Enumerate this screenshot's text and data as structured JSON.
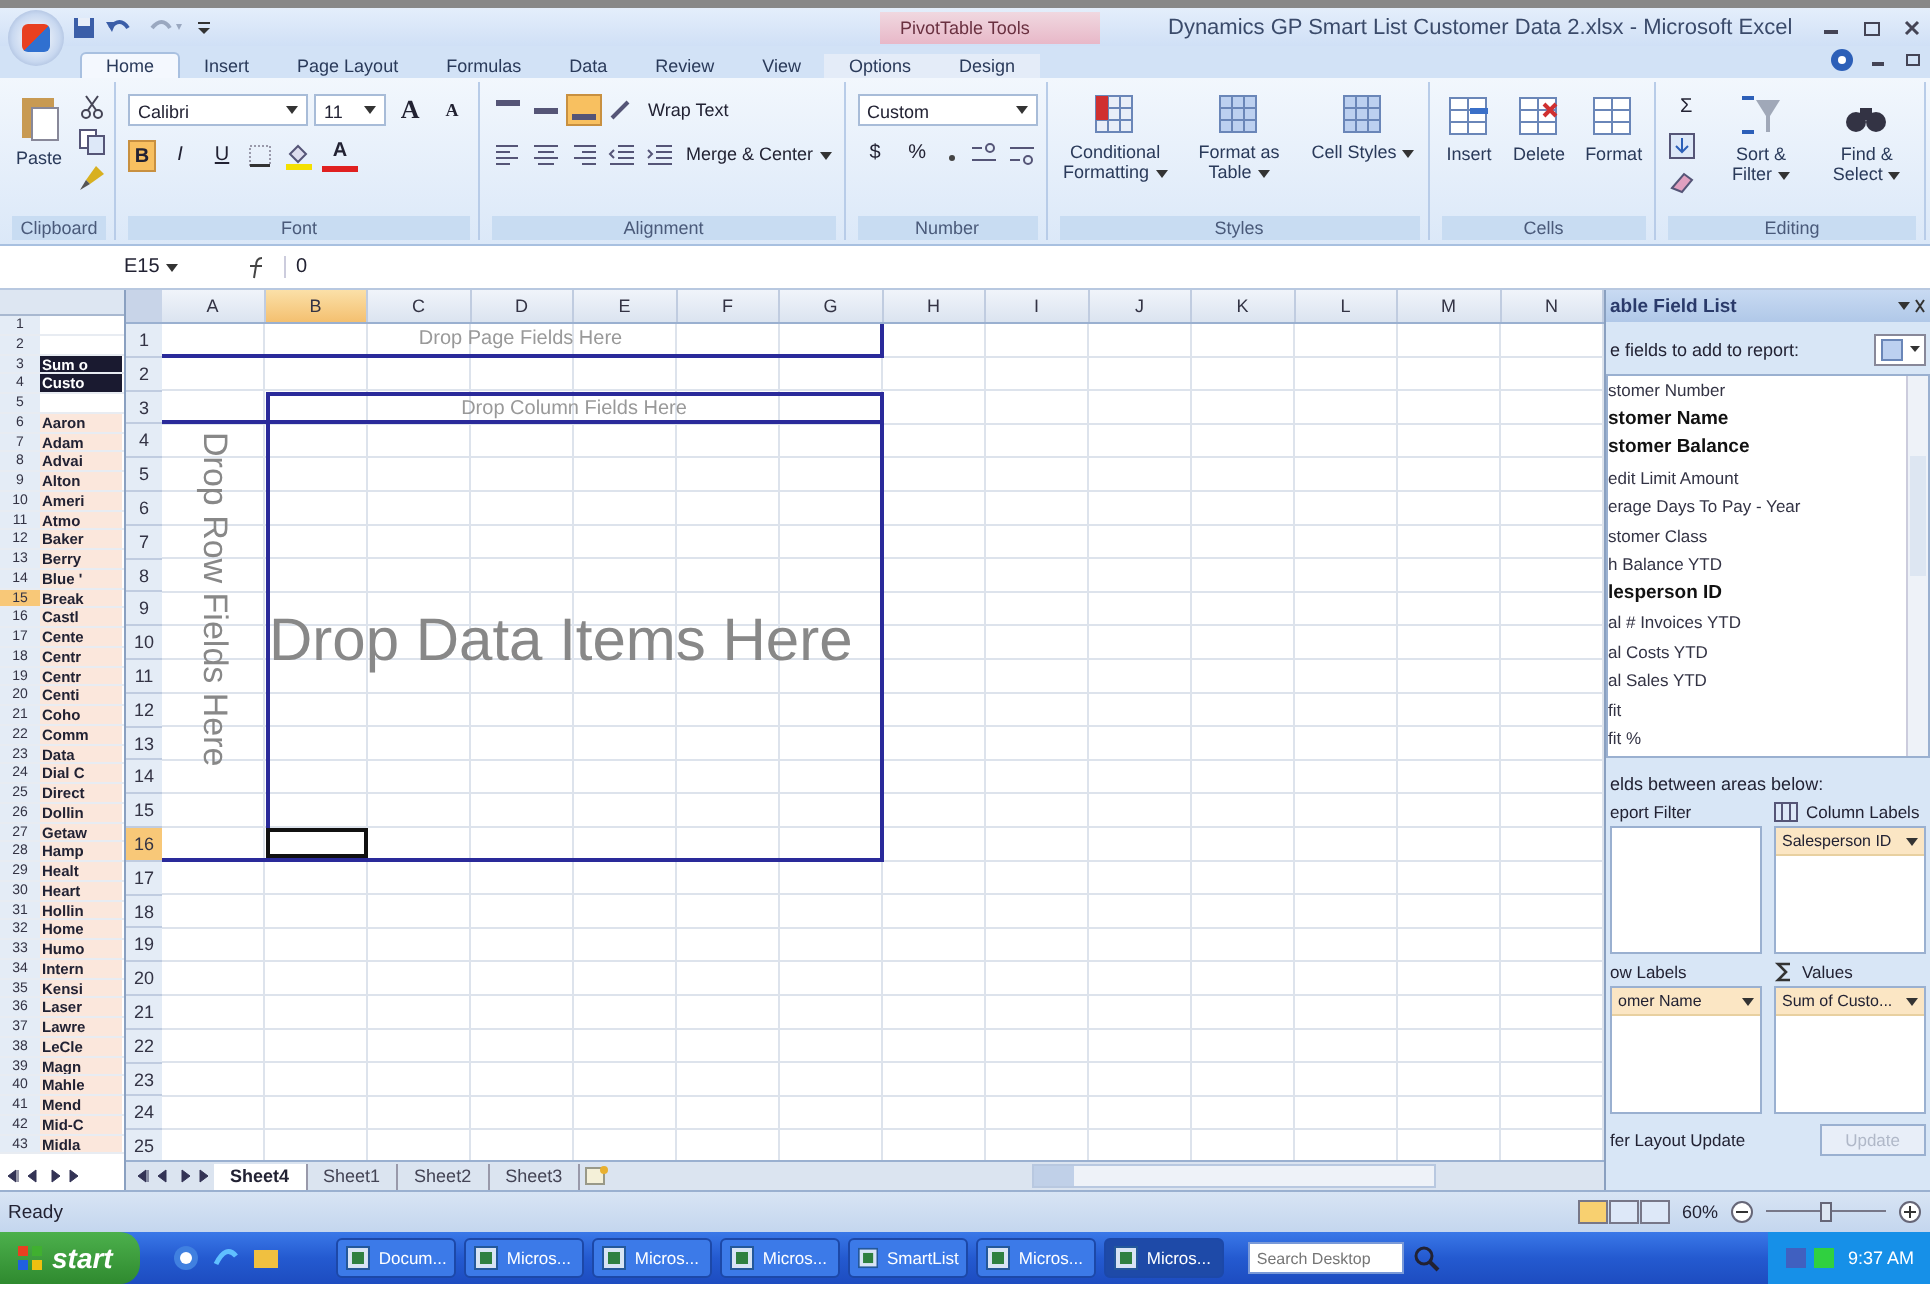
{
  "title_bar": {
    "context_label": "PivotTable Tools",
    "title": "Dynamics GP Smart List Customer Data 2.xlsx - Microsoft Excel"
  },
  "ribbon_tabs": [
    {
      "label": "Home",
      "selected": true
    },
    {
      "label": "Insert",
      "selected": false
    },
    {
      "label": "Page Layout",
      "selected": false
    },
    {
      "label": "Formulas",
      "selected": false
    },
    {
      "label": "Data",
      "selected": false
    },
    {
      "label": "Review",
      "selected": false
    },
    {
      "label": "View",
      "selected": false
    },
    {
      "label": "Options",
      "selected": false
    },
    {
      "label": "Design",
      "selected": false
    }
  ],
  "ribbon": {
    "clipboard": {
      "paste": "Paste",
      "label": "Clipboard"
    },
    "font": {
      "name": "Calibri",
      "size": "11",
      "grow": "A",
      "shrink": "A",
      "bold": {
        "label": "B",
        "on": true
      },
      "italic": "I",
      "underline": "U",
      "color_button": "A",
      "label": "Font"
    },
    "alignment": {
      "middle_on": true,
      "wrap": "Wrap Text",
      "merge": "Merge & Center",
      "label": "Alignment"
    },
    "number": {
      "format": "Custom",
      "currency": "$",
      "percent": "%",
      "label": "Number"
    },
    "styles": {
      "buttons": [
        "Conditional Formatting",
        "Format as Table",
        "Cell Styles"
      ],
      "label": "Styles"
    },
    "cells": {
      "buttons": [
        "Insert",
        "Delete",
        "Format"
      ],
      "label": "Cells"
    },
    "editing": {
      "buttons": [
        "Sort & Filter",
        "Find & Select"
      ],
      "sum": "Σ",
      "label": "Editing"
    }
  },
  "formula_bar": {
    "name_box": "E15",
    "value": "0"
  },
  "background_sheet": {
    "rows": [
      {
        "number": "1",
        "selected": false
      },
      {
        "number": "2",
        "selected": false
      },
      {
        "number": "3",
        "cell": "Sum o",
        "header": true,
        "selected": false
      },
      {
        "number": "4",
        "cell": "Custo",
        "header": true,
        "selected": false
      },
      {
        "number": "5",
        "selected": false
      },
      {
        "number": "6",
        "cell": "Aaron",
        "header": false,
        "selected": false
      },
      {
        "number": "7",
        "cell": "Adam",
        "header": false,
        "selected": false
      },
      {
        "number": "8",
        "cell": "Advai",
        "header": false,
        "selected": false
      },
      {
        "number": "9",
        "cell": "Alton",
        "header": false,
        "selected": false
      },
      {
        "number": "10",
        "cell": "Ameri",
        "header": false,
        "selected": false
      },
      {
        "number": "11",
        "cell": "Atmo",
        "header": false,
        "selected": false
      },
      {
        "number": "12",
        "cell": "Baker",
        "header": false,
        "selected": false
      },
      {
        "number": "13",
        "cell": "Berry",
        "header": false,
        "selected": false
      },
      {
        "number": "14",
        "cell": "Blue '",
        "header": false,
        "selected": false
      },
      {
        "number": "15",
        "cell": "Break",
        "header": false,
        "selected": true
      },
      {
        "number": "16",
        "cell": "Castl",
        "header": false,
        "selected": false
      },
      {
        "number": "17",
        "cell": "Cente",
        "header": false,
        "selected": false
      },
      {
        "number": "18",
        "cell": "Centr",
        "header": false,
        "selected": false
      },
      {
        "number": "19",
        "cell": "Centr",
        "header": false,
        "selected": false
      },
      {
        "number": "20",
        "cell": "Centi",
        "header": false,
        "selected": false
      },
      {
        "number": "21",
        "cell": "Coho",
        "header": false,
        "selected": false
      },
      {
        "number": "22",
        "cell": "Comm",
        "header": false,
        "selected": false
      },
      {
        "number": "23",
        "cell": "Data",
        "header": false,
        "selected": false
      },
      {
        "number": "24",
        "cell": "Dial C",
        "header": false,
        "selected": false
      },
      {
        "number": "25",
        "cell": "Direct",
        "header": false,
        "selected": false
      },
      {
        "number": "26",
        "cell": "Dollin",
        "header": false,
        "selected": false
      },
      {
        "number": "27",
        "cell": "Getaw",
        "header": false,
        "selected": false
      },
      {
        "number": "28",
        "cell": "Hamp",
        "header": false,
        "selected": false
      },
      {
        "number": "29",
        "cell": "Healt",
        "header": false,
        "selected": false
      },
      {
        "number": "30",
        "cell": "Heart",
        "header": false,
        "selected": false
      },
      {
        "number": "31",
        "cell": "Hollin",
        "header": false,
        "selected": false
      },
      {
        "number": "32",
        "cell": "Home",
        "header": false,
        "selected": false
      },
      {
        "number": "33",
        "cell": "Humo",
        "header": false,
        "selected": false
      },
      {
        "number": "34",
        "cell": "Intern",
        "header": false,
        "selected": false
      },
      {
        "number": "35",
        "cell": "Kensi",
        "header": false,
        "selected": false
      },
      {
        "number": "36",
        "cell": "Laser",
        "header": false,
        "selected": false
      },
      {
        "number": "37",
        "cell": "Lawre",
        "header": false,
        "selected": false
      },
      {
        "number": "38",
        "cell": "LeCle",
        "header": false,
        "selected": false
      },
      {
        "number": "39",
        "cell": "Magn",
        "header": false,
        "selected": false
      },
      {
        "number": "40",
        "cell": "Mahle",
        "header": false,
        "selected": false
      },
      {
        "number": "41",
        "cell": "Mend",
        "header": false,
        "selected": false
      },
      {
        "number": "42",
        "cell": "Mid-C",
        "header": false,
        "selected": false
      },
      {
        "number": "43",
        "cell": "Midla",
        "header": false,
        "selected": false
      }
    ]
  },
  "sheet": {
    "columns": [
      {
        "label": "A",
        "selected": false
      },
      {
        "label": "B",
        "selected": true
      },
      {
        "label": "C",
        "selected": false
      },
      {
        "label": "D",
        "selected": false
      },
      {
        "label": "E",
        "selected": false
      },
      {
        "label": "F",
        "selected": false
      },
      {
        "label": "G",
        "selected": false
      },
      {
        "label": "H",
        "selected": false
      },
      {
        "label": "I",
        "selected": false
      },
      {
        "label": "J",
        "selected": false
      },
      {
        "label": "K",
        "selected": false
      },
      {
        "label": "L",
        "selected": false
      },
      {
        "label": "M",
        "selected": false
      },
      {
        "label": "N",
        "selected": false
      }
    ],
    "rows": [
      {
        "label": "1",
        "selected": false
      },
      {
        "label": "2",
        "selected": false
      },
      {
        "label": "3",
        "selected": false
      },
      {
        "label": "4",
        "selected": false
      },
      {
        "label": "5",
        "selected": false
      },
      {
        "label": "6",
        "selected": false
      },
      {
        "label": "7",
        "selected": false
      },
      {
        "label": "8",
        "selected": false
      },
      {
        "label": "9",
        "selected": false
      },
      {
        "label": "10",
        "selected": false
      },
      {
        "label": "11",
        "selected": false
      },
      {
        "label": "12",
        "selected": false
      },
      {
        "label": "13",
        "selected": false
      },
      {
        "label": "14",
        "selected": false
      },
      {
        "label": "15",
        "selected": false
      },
      {
        "label": "16",
        "selected": true
      },
      {
        "label": "17",
        "selected": false
      },
      {
        "label": "18",
        "selected": false
      },
      {
        "label": "19",
        "selected": false
      },
      {
        "label": "20",
        "selected": false
      },
      {
        "label": "21",
        "selected": false
      },
      {
        "label": "22",
        "selected": false
      },
      {
        "label": "23",
        "selected": false
      },
      {
        "label": "24",
        "selected": false
      },
      {
        "label": "25",
        "selected": false
      }
    ],
    "pivot": {
      "page_fields": "Drop Page Fields Here",
      "column_fields": "Drop Column Fields Here",
      "row_fields": "Drop Row Fields Here",
      "data_items": "Drop Data Items Here"
    },
    "tabs": [
      {
        "label": "Sheet4",
        "selected": true
      },
      {
        "label": "Sheet1",
        "selected": false
      },
      {
        "label": "Sheet2",
        "selected": false
      },
      {
        "label": "Sheet3",
        "selected": false
      }
    ]
  },
  "field_list": {
    "title": "able Field List",
    "prompt": "e fields to add to report:",
    "fields": [
      {
        "label": "stomer Number",
        "checked": false
      },
      {
        "label": "stomer Name",
        "checked": true
      },
      {
        "label": "stomer Balance",
        "checked": true
      },
      {
        "label": "edit Limit Amount",
        "checked": false
      },
      {
        "label": "erage Days To Pay - Year",
        "checked": false
      },
      {
        "label": "stomer Class",
        "checked": false
      },
      {
        "label": "h Balance YTD",
        "checked": false
      },
      {
        "label": "lesperson ID",
        "checked": true
      },
      {
        "label": "al # Invoices YTD",
        "checked": false
      },
      {
        "label": "al Costs YTD",
        "checked": false
      },
      {
        "label": "al Sales YTD",
        "checked": false
      },
      {
        "label": "fit",
        "checked": false
      },
      {
        "label": "fit %",
        "checked": false
      }
    ],
    "areas_prompt": "elds between areas below:",
    "areas": [
      {
        "label": "eport Filter",
        "kind": "filter"
      },
      {
        "label": "Column Labels",
        "kind": "columns",
        "items": [
          "Salesperson ID"
        ]
      },
      {
        "label": "ow Labels",
        "kind": "rows",
        "items": [
          "omer Name"
        ]
      },
      {
        "label": "Values",
        "kind": "values",
        "items": [
          "Sum of Custo..."
        ]
      }
    ],
    "defer_label": "fer Layout Update",
    "update_button": {
      "label": "Update",
      "disabled": true
    }
  },
  "status_bar": {
    "status": "Ready",
    "zoom": "60%",
    "zoom_slider": {
      "level": 0.5
    }
  },
  "taskbar": {
    "start": "start",
    "items": [
      {
        "label": "Docum...",
        "selected": false
      },
      {
        "label": "Micros...",
        "selected": false
      },
      {
        "label": "Micros...",
        "selected": false
      },
      {
        "label": "Micros...",
        "selected": false
      },
      {
        "label": "SmartList",
        "selected": false
      },
      {
        "label": "Micros...",
        "selected": false
      },
      {
        "label": "Micros...",
        "selected": true
      }
    ],
    "search_placeholder": "Search Desktop",
    "clock": "9:37 AM"
  }
}
